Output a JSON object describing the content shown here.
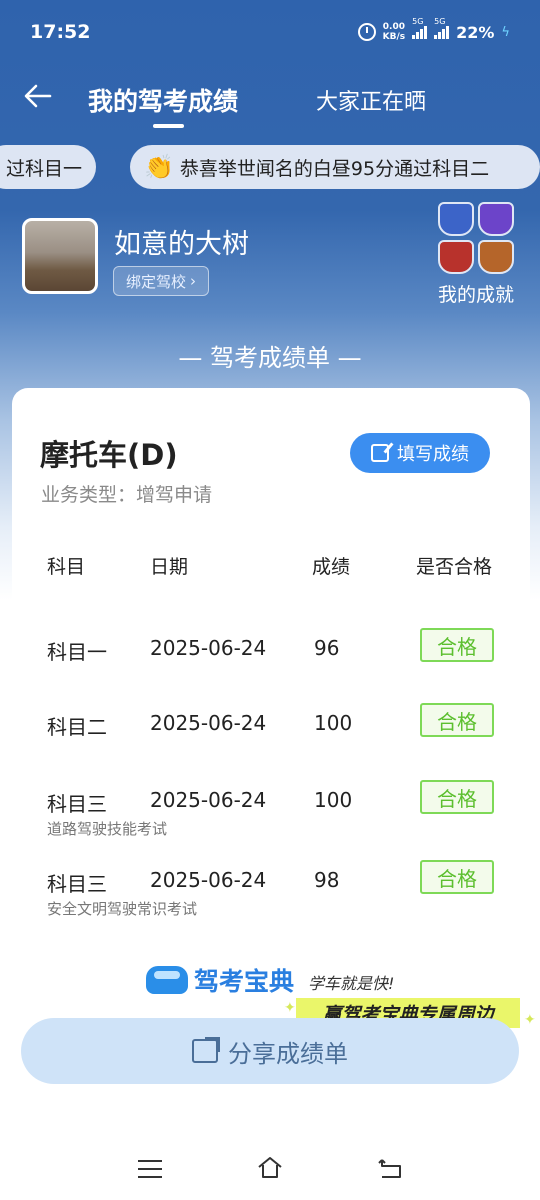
{
  "status": {
    "time": "17:52",
    "speed_top": "0.00",
    "speed_unit": "KB/s",
    "net1": "5G",
    "net2": "5G",
    "battery": "22%"
  },
  "header": {
    "back_icon": "arrow-left-icon",
    "tab_mine": "我的驾考成绩",
    "tab_others": "大家正在晒"
  },
  "ticker": {
    "left_text": "过科目一",
    "right_text": "恭喜举世闻名的白昼95分通过科目二",
    "clap_icon": "👏"
  },
  "profile": {
    "username": "如意的大树",
    "bind_label": "绑定驾校",
    "bind_chevron": "›",
    "achievement_label": "我的成就"
  },
  "section_title": "— 驾考成绩单 —",
  "card": {
    "vehicle": "摩托车(D)",
    "business": "业务类型：增驾申请",
    "fill_button": "填写成绩",
    "columns": [
      "科目",
      "日期",
      "成绩",
      "是否合格"
    ],
    "rows": [
      {
        "subject": "科目一",
        "date": "2025-06-24",
        "score": "96",
        "result": "合格",
        "sub": ""
      },
      {
        "subject": "科目二",
        "date": "2025-06-24",
        "score": "100",
        "result": "合格",
        "sub": ""
      },
      {
        "subject": "科目三",
        "date": "2025-06-24",
        "score": "100",
        "result": "合格",
        "sub": "道路驾驶技能考试"
      },
      {
        "subject": "科目三",
        "date": "2025-06-24",
        "score": "98",
        "result": "合格",
        "sub": "安全文明驾驶常识考试"
      }
    ]
  },
  "brand": {
    "name": "驾考宝典",
    "slogan": "学车就是快!",
    "promo": "赢驾考宝典专属周边"
  },
  "share_button": "分享成绩单",
  "colors": {
    "primary": "#2f63ad",
    "accent": "#3b8ef0",
    "pass": "#5cbf2f",
    "share_bg": "#cfe3f8"
  }
}
